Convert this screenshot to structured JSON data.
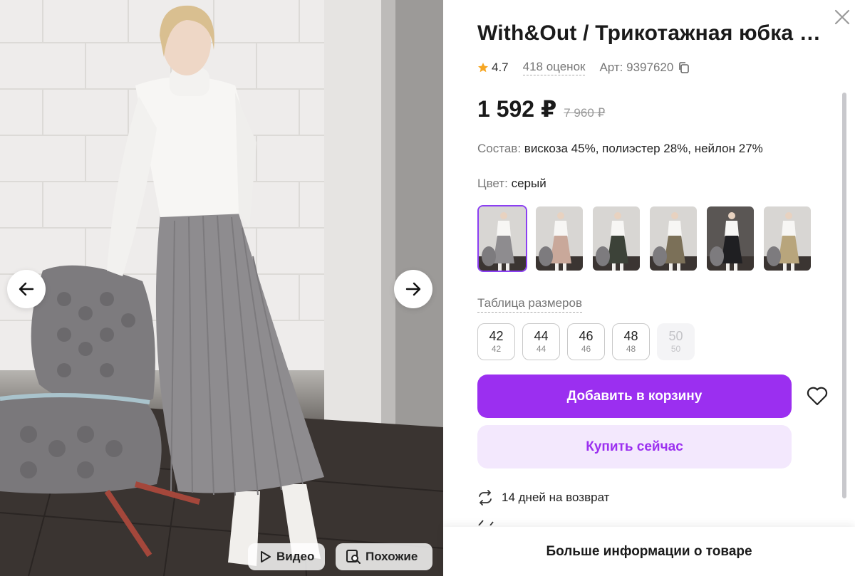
{
  "product": {
    "title": "With&Out / Трикотажная юбка трикотажная",
    "rating": "4.7",
    "reviews": "418 оценок",
    "article": "Арт: 9397620",
    "price": "1 592 ₽",
    "old_price": "7 960 ₽",
    "composition_label": "Состав:",
    "composition_value": "вискоза 45%, полиэстер 28%, нейлон 27%",
    "color_label": "Цвет:",
    "color_value": "серый"
  },
  "swatches": [
    {
      "name": "grey",
      "skirt": "#8e8c8f",
      "active": true
    },
    {
      "name": "beige-pink",
      "skirt": "#c9a89a",
      "active": false
    },
    {
      "name": "dark-green",
      "skirt": "#3c4238",
      "active": false
    },
    {
      "name": "olive",
      "skirt": "#7b7058",
      "active": false
    },
    {
      "name": "black",
      "skirt": "#1f1f22",
      "active": false
    },
    {
      "name": "sand",
      "skirt": "#b8a57c",
      "active": false
    }
  ],
  "size_chart_label": "Таблица размеров",
  "sizes": [
    {
      "main": "42",
      "sub": "42",
      "available": true
    },
    {
      "main": "44",
      "sub": "44",
      "available": true
    },
    {
      "main": "46",
      "sub": "46",
      "available": true
    },
    {
      "main": "48",
      "sub": "48",
      "available": true
    },
    {
      "main": "50",
      "sub": "50",
      "available": false
    }
  ],
  "actions": {
    "add_to_cart": "Добавить в корзину",
    "buy_now": "Купить сейчас",
    "more_info": "Больше информации о товаре"
  },
  "returns_text": "14 дней на возврат",
  "photo_buttons": {
    "video": "Видео",
    "similar": "Похожие"
  },
  "colors": {
    "accent": "#9b2ff0",
    "accent_light": "#f3e8fd",
    "star": "#f6a623"
  }
}
